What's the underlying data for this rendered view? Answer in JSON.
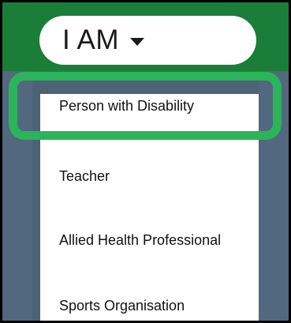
{
  "header": {
    "dropdown_label": "I AM",
    "caret_icon": "caret-down-icon"
  },
  "menu": {
    "items": [
      {
        "label": "Person with Disability",
        "selected": true
      },
      {
        "label": "Teacher",
        "selected": false
      },
      {
        "label": "Allied Health Professional",
        "selected": false
      },
      {
        "label": "Sports Organisation",
        "selected": false
      }
    ]
  },
  "colors": {
    "header_green": "#1a7d38",
    "highlight_green": "#2bb45a",
    "backdrop": "#4d6277"
  }
}
